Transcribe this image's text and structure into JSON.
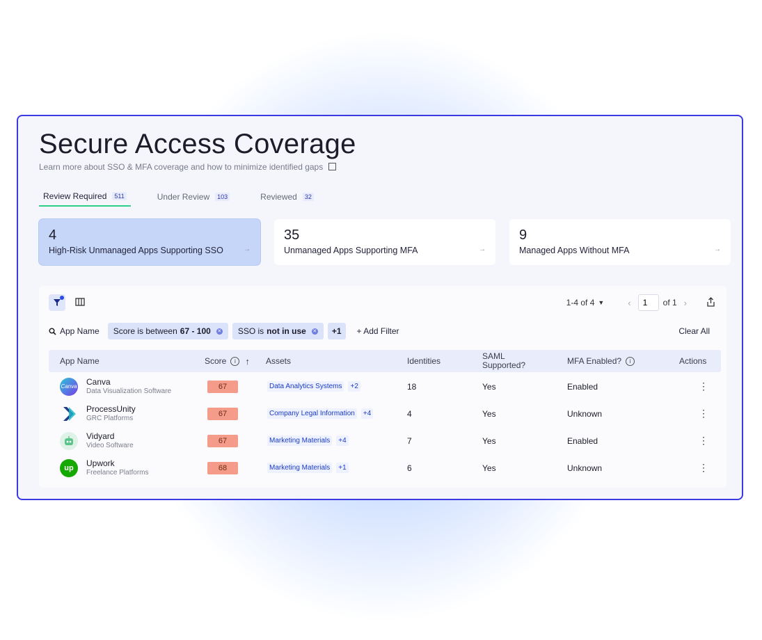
{
  "page": {
    "title": "Secure Access Coverage",
    "subtitle": "Learn more about SSO & MFA coverage and how to minimize identified gaps"
  },
  "tabs": [
    {
      "label": "Review Required",
      "count": "511"
    },
    {
      "label": "Under Review",
      "count": "103"
    },
    {
      "label": "Reviewed",
      "count": "32"
    }
  ],
  "cards": [
    {
      "value": "4",
      "label": "High-Risk Unmanaged Apps Supporting SSO"
    },
    {
      "value": "35",
      "label": "Unmanaged Apps Supporting MFA"
    },
    {
      "value": "9",
      "label": "Managed Apps Without MFA"
    }
  ],
  "pager": {
    "range": "1-4 of 4",
    "page": "1",
    "of": "of 1"
  },
  "filters": {
    "search_label": "App Name",
    "chip1_prefix": "Score is between",
    "chip1_bold": "67 - 100",
    "chip2_prefix": "SSO is",
    "chip2_bold": "not in use",
    "more": "+1",
    "add_filter": "+ Add Filter",
    "clear_all": "Clear All"
  },
  "table": {
    "headers": {
      "app": "App Name",
      "score": "Score",
      "assets": "Assets",
      "identities": "Identities",
      "saml": "SAML Supported?",
      "mfa": "MFA Enabled?",
      "actions": "Actions"
    },
    "rows": [
      {
        "name": "Canva",
        "category": "Data Visualization Software",
        "score": "67",
        "asset": "Data Analytics Systems",
        "asset_more": "+2",
        "identities": "18",
        "saml": "Yes",
        "mfa": "Enabled",
        "logo_text": "Canva"
      },
      {
        "name": "ProcessUnity",
        "category": "GRC Platforms",
        "score": "67",
        "asset": "Company Legal Information",
        "asset_more": "+4",
        "identities": "4",
        "saml": "Yes",
        "mfa": "Unknown",
        "logo_text": ""
      },
      {
        "name": "Vidyard",
        "category": "Video Software",
        "score": "67",
        "asset": "Marketing Materials",
        "asset_more": "+4",
        "identities": "7",
        "saml": "Yes",
        "mfa": "Enabled",
        "logo_text": ""
      },
      {
        "name": "Upwork",
        "category": "Freelance Platforms",
        "score": "68",
        "asset": "Marketing Materials",
        "asset_more": "+1",
        "identities": "6",
        "saml": "Yes",
        "mfa": "Unknown",
        "logo_text": "up"
      }
    ]
  },
  "colors": {
    "accent": "#2fcf8a",
    "panel_border": "#3a3ae0",
    "score_bg": "#f49b89",
    "active_card": "#c6d6f8"
  }
}
